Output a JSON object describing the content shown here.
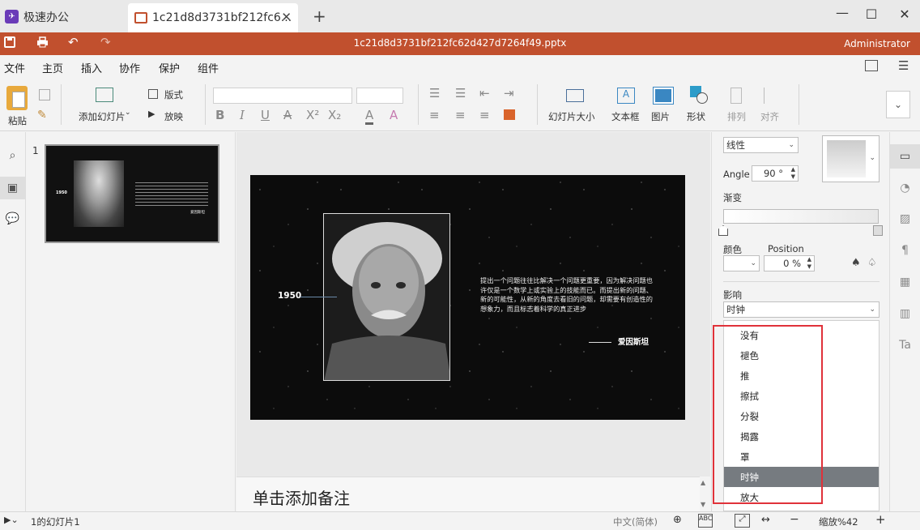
{
  "app": {
    "home_tab": "极速办公",
    "doc_tab": "1c21d8d3731bf212fc6...",
    "file_title": "1c21d8d3731bf212fc62d427d7264f49.pptx",
    "user": "Administrator",
    "brand_color": "#c1502e"
  },
  "menu": [
    "文件",
    "主页",
    "插入",
    "协作",
    "保护",
    "组件"
  ],
  "ribbon": {
    "paste": "粘贴",
    "add_slide": "添加幻灯片",
    "layout": "版式",
    "play": "放映",
    "slide_size": "幻灯片大小",
    "textbox": "文本框",
    "picture": "图片",
    "shape": "形状",
    "arrange": "排列",
    "align": "对齐"
  },
  "thumb": {
    "number": "1",
    "year": "1950",
    "author": "爱因斯坦"
  },
  "slide": {
    "year": "1950",
    "quote": "提出一个问题往往比解决一个问题更重要，因为解决问题也许仅是一个数学上或实验上的技能而已。而提出新的问题、新的可能性，从新的角度去看旧的问题，却需要有创造性的想象力，而且标志着科学的真正进步",
    "author": "爱因斯坦"
  },
  "notes_placeholder": "单击添加备注",
  "panel": {
    "fill_type": "线性",
    "angle_label": "Angle",
    "angle_value": "90 °",
    "gradient_label": "渐变",
    "color_label": "颜色",
    "position_label": "Position",
    "position_value": "0 %",
    "effect_label": "影响",
    "effect_value": "时钟"
  },
  "effect_options": [
    "没有",
    "褪色",
    "推",
    "擦拭",
    "分裂",
    "揭露",
    "罩",
    "时钟",
    "放大"
  ],
  "status": {
    "slide_info": "1的幻灯片1",
    "language": "中文(简体)",
    "zoom": "缩放%42"
  }
}
